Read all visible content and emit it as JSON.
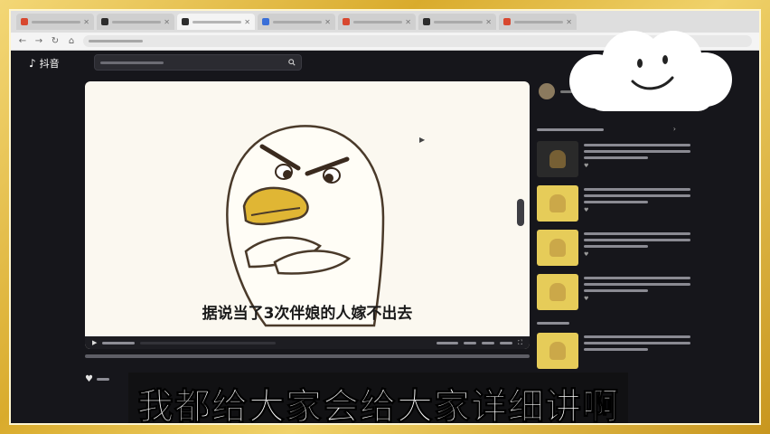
{
  "app": {
    "logo_text": "抖音"
  },
  "video": {
    "subtitle": "据说当了3次伴娘的人嫁不出去"
  },
  "caption": {
    "text": "我都给大家会给大家详细讲啊"
  },
  "colors": {
    "frame_gold": "#e9c74f",
    "page_bg": "#16161b",
    "player_bg": "#fbf8f0",
    "duck_beak": "#e0b634"
  },
  "icons": {
    "logo": "tiktok-icon",
    "search": "search-icon",
    "like": "heart-icon",
    "mascot": "duck-illustration",
    "sticker": "smiling-cloud"
  }
}
